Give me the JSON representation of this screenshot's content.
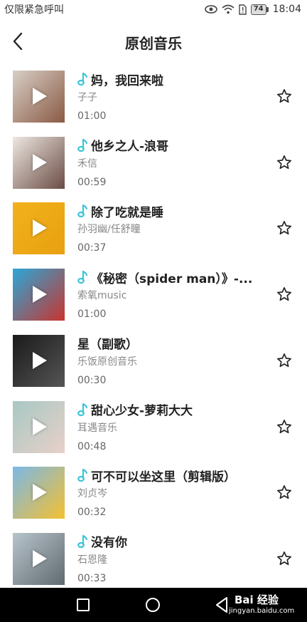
{
  "status_bar": {
    "left_text": "仅限紧急呼叫",
    "battery": "74",
    "time": "18:04"
  },
  "header": {
    "back_icon": "chevron-left-icon",
    "title": "原创音乐"
  },
  "songs": [
    {
      "title": "妈，我回来啦",
      "artist": "子子",
      "duration": "01:00",
      "has_note_icon": true,
      "cover_colors": [
        "#d8cfc6",
        "#8a5a44"
      ]
    },
    {
      "title": "他乡之人-浪哥",
      "artist": "禾信",
      "duration": "00:59",
      "has_note_icon": true,
      "cover_colors": [
        "#eee8e2",
        "#6a4c44"
      ]
    },
    {
      "title": "除了吃就是睡",
      "artist": "孙羽幽/任舒瞳",
      "duration": "00:37",
      "has_note_icon": true,
      "cover_colors": [
        "#f2b21c",
        "#e8a010"
      ]
    },
    {
      "title": "《秘密（spider man）》-...",
      "artist": "索氧music",
      "duration": "01:00",
      "has_note_icon": true,
      "cover_colors": [
        "#2aa8d8",
        "#c8342e"
      ]
    },
    {
      "title": "星（副歌）",
      "artist": "乐饭原创音乐",
      "duration": "00:30",
      "has_note_icon": false,
      "cover_colors": [
        "#1a1a1a",
        "#555555"
      ]
    },
    {
      "title": "甜心少女-萝莉大大",
      "artist": "耳遇音乐",
      "duration": "00:48",
      "has_note_icon": true,
      "cover_colors": [
        "#a8c8c4",
        "#e8d0c8"
      ]
    },
    {
      "title": "可不可以坐这里（剪辑版）",
      "artist": "刘贞岑",
      "duration": "00:32",
      "has_note_icon": true,
      "cover_colors": [
        "#7ab8e8",
        "#f4c030"
      ]
    },
    {
      "title": "没有你",
      "artist": "石恩隆",
      "duration": "00:33",
      "has_note_icon": true,
      "cover_colors": [
        "#b8c4cc",
        "#606a70"
      ]
    }
  ],
  "colors": {
    "accent_note": "#3ec4d8",
    "text_primary": "#222222",
    "text_secondary": "#888888",
    "nav_bar": "#000000"
  },
  "nav_bar": {
    "recent_icon": "square-icon",
    "home_icon": "circle-icon",
    "back_icon": "triangle-back-icon",
    "watermark_top": "Bai 经验",
    "watermark_bottom": "jingyan.baidu.com"
  }
}
